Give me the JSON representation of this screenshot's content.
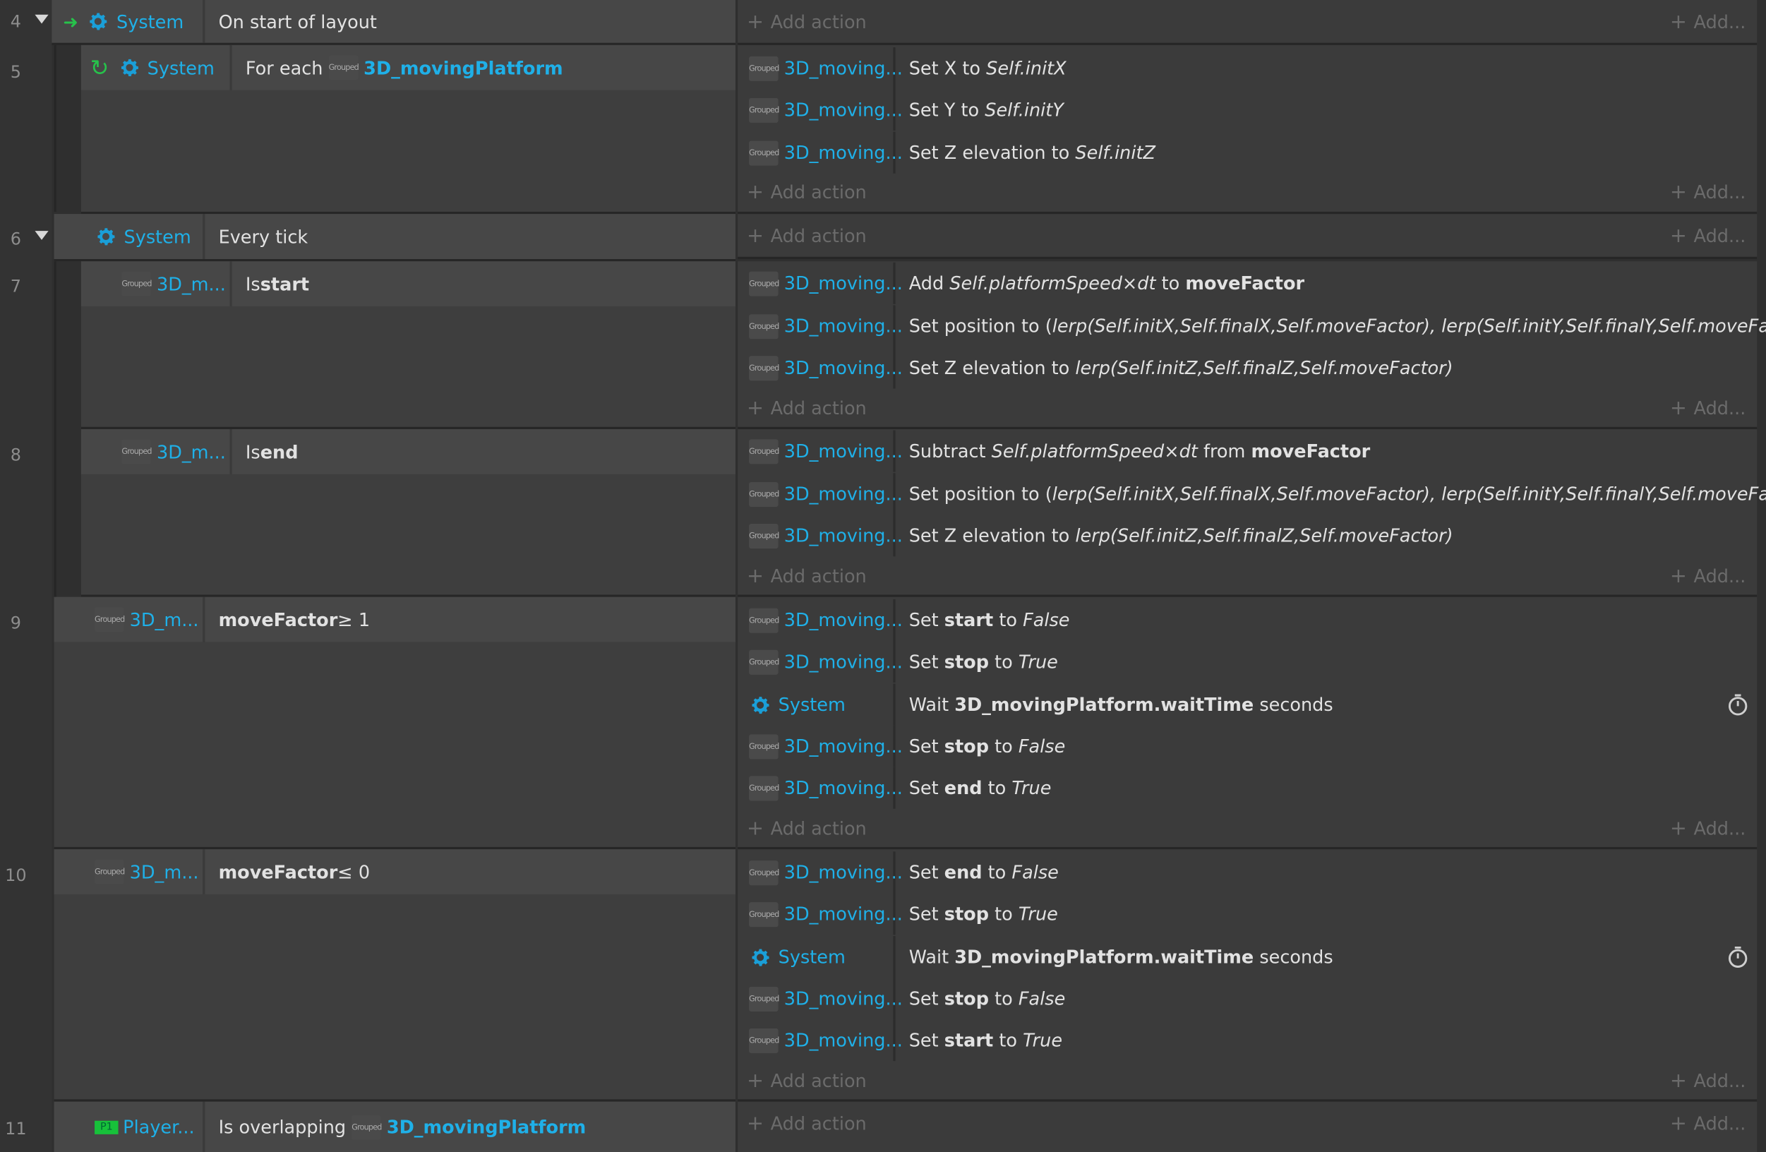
{
  "colors": {
    "accent": "#1fb0e8",
    "bg": "#2f2f2f",
    "event": "#474747",
    "action": "#3b3b3b"
  },
  "common": {
    "add_action": "Add action",
    "add": "Add...",
    "system": "System",
    "moving_short": "3D_moving...",
    "m_short": "3D_m...",
    "platform": "3D_movingPlatform",
    "obj_icon": "Grouped",
    "player_short": "Player...",
    "p1": "P1"
  },
  "events": [
    {
      "line": "4",
      "cond": "On start of layout"
    },
    {
      "line": "5",
      "cond_prefix": "For each",
      "actions": [
        {
          "pre": "Set X to ",
          "v": "Self.initX"
        },
        {
          "pre": "Set Y to ",
          "v": "Self.initY"
        },
        {
          "pre": "Set Z elevation to ",
          "v": "Self.initZ"
        }
      ]
    },
    {
      "line": "6",
      "cond": "Every tick"
    },
    {
      "line": "7",
      "cond_pre": "Is ",
      "cond_bold": "start",
      "actions": [
        {
          "pre": "Add ",
          "v": "Self.platformSpeed×dt",
          "mid": " to ",
          "b": "moveFactor"
        },
        {
          "pre": "Set position to (",
          "v": "lerp(Self.initX,Self.finalX,Self.moveFactor), lerp(Self.initY,Self.finalY,Self.moveFactor)",
          "post": ")"
        },
        {
          "pre": "Set Z elevation to ",
          "v": "lerp(Self.initZ,Self.finalZ,Self.moveFactor)"
        }
      ]
    },
    {
      "line": "8",
      "cond_pre": "Is ",
      "cond_bold": "end",
      "actions": [
        {
          "pre": "Subtract ",
          "v": "Self.platformSpeed×dt",
          "mid": " from ",
          "b": "moveFactor"
        },
        {
          "pre": "Set position to (",
          "v": "lerp(Self.initX,Self.finalX,Self.moveFactor), lerp(Self.initY,Self.finalY,Self.moveFactor)",
          "post": ")"
        },
        {
          "pre": "Set Z elevation to ",
          "v": "lerp(Self.initZ,Self.finalZ,Self.moveFactor)"
        }
      ]
    },
    {
      "line": "9",
      "cond_bold": "moveFactor",
      "cond_post": " ≥ 1",
      "actions": [
        {
          "pre": "Set ",
          "b": "start",
          "mid": " to ",
          "v": "False"
        },
        {
          "pre": "Set ",
          "b": "stop",
          "mid": " to ",
          "v": "True"
        },
        {
          "pre": "Wait ",
          "b": "3D_movingPlatform.waitTime",
          "mid": " seconds"
        },
        {
          "pre": "Set ",
          "b": "stop",
          "mid": " to ",
          "v": "False"
        },
        {
          "pre": "Set ",
          "b": "end",
          "mid": " to ",
          "v": "True"
        }
      ]
    },
    {
      "line": "10",
      "cond_bold": "moveFactor",
      "cond_post": " ≤ 0",
      "actions": [
        {
          "pre": "Set ",
          "b": "end",
          "mid": " to ",
          "v": "False"
        },
        {
          "pre": "Set ",
          "b": "stop",
          "mid": " to ",
          "v": "True"
        },
        {
          "pre": "Wait ",
          "b": "3D_movingPlatform.waitTime",
          "mid": " seconds"
        },
        {
          "pre": "Set ",
          "b": "stop",
          "mid": " to ",
          "v": "False"
        },
        {
          "pre": "Set ",
          "b": "start",
          "mid": " to ",
          "v": "True"
        }
      ]
    },
    {
      "line": "11",
      "cond_pre": "Is overlapping"
    }
  ]
}
